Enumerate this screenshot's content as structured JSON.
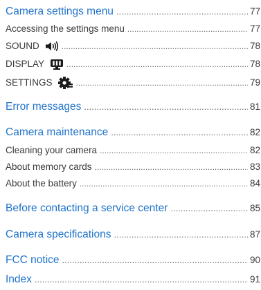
{
  "toc": {
    "camera_settings_menu": {
      "label": "Camera settings menu",
      "page": "77"
    },
    "accessing_settings": {
      "label": "Accessing the settings menu",
      "page": "77"
    },
    "sound": {
      "label": "SOUND",
      "page": "78",
      "icon": "speaker-icon"
    },
    "display": {
      "label": "DISPLAY",
      "page": "78",
      "icon": "monitor-icon"
    },
    "settings": {
      "label": "SETTINGS",
      "page": "79",
      "icon": "gear-icon"
    },
    "error_messages": {
      "label": "Error messages",
      "page": "81"
    },
    "camera_maintenance": {
      "label": "Camera maintenance",
      "page": "82"
    },
    "cleaning": {
      "label": "Cleaning your camera",
      "page": "82"
    },
    "memory_cards": {
      "label": "About memory cards",
      "page": "83"
    },
    "battery": {
      "label": "About the battery",
      "page": "84"
    },
    "service_center": {
      "label": "Before contacting a service center",
      "page": "85"
    },
    "specifications": {
      "label": "Camera specifications",
      "page": "87"
    },
    "fcc_notice": {
      "label": "FCC notice",
      "page": "90"
    },
    "index": {
      "label": "Index",
      "page": "91"
    }
  },
  "colors": {
    "heading": "#1f73c9",
    "text": "#3a3a3a",
    "leader": "#6a6a6a"
  }
}
